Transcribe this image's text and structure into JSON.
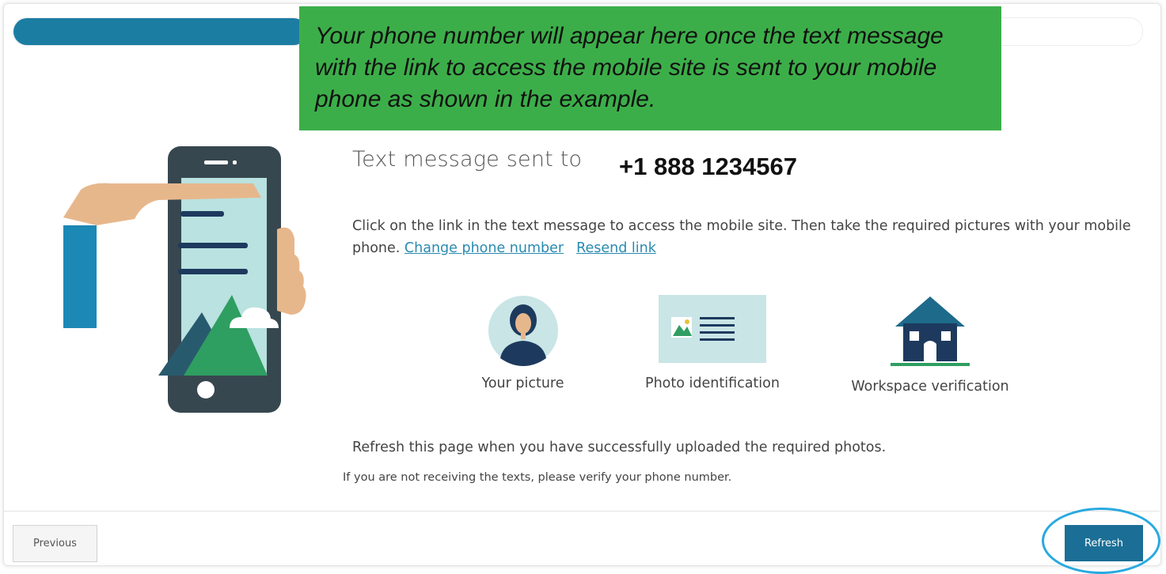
{
  "progress": {
    "fraction": 0.26
  },
  "callout": {
    "text": "Your phone number will appear here once the text message with the link to access the mobile site is sent to your mobile phone as shown in the example."
  },
  "heading": {
    "label": "Text message sent to",
    "phone": "+1 888 1234567"
  },
  "instructions": {
    "text": "Click on the link in the text message to access the mobile site. Then take the required pictures with your mobile phone.",
    "change_link": "Change phone number",
    "resend_link": "Resend link"
  },
  "steps": [
    {
      "label": "Your picture",
      "icon": "person-avatar-icon"
    },
    {
      "label": "Photo identification",
      "icon": "photo-id-card-icon"
    },
    {
      "label": "Workspace verification",
      "icon": "house-icon"
    }
  ],
  "refresh_note": "Refresh this page when you have successfully uploaded the required photos.",
  "verify_note": "If you are not receiving the texts, please verify your phone number.",
  "buttons": {
    "previous": "Previous",
    "refresh": "Refresh"
  },
  "colors": {
    "accent": "#1b6f96",
    "progress": "#1c7da3",
    "callout": "#3cae49",
    "link": "#2a8ab0",
    "highlight_ring": "#29a9e0"
  }
}
